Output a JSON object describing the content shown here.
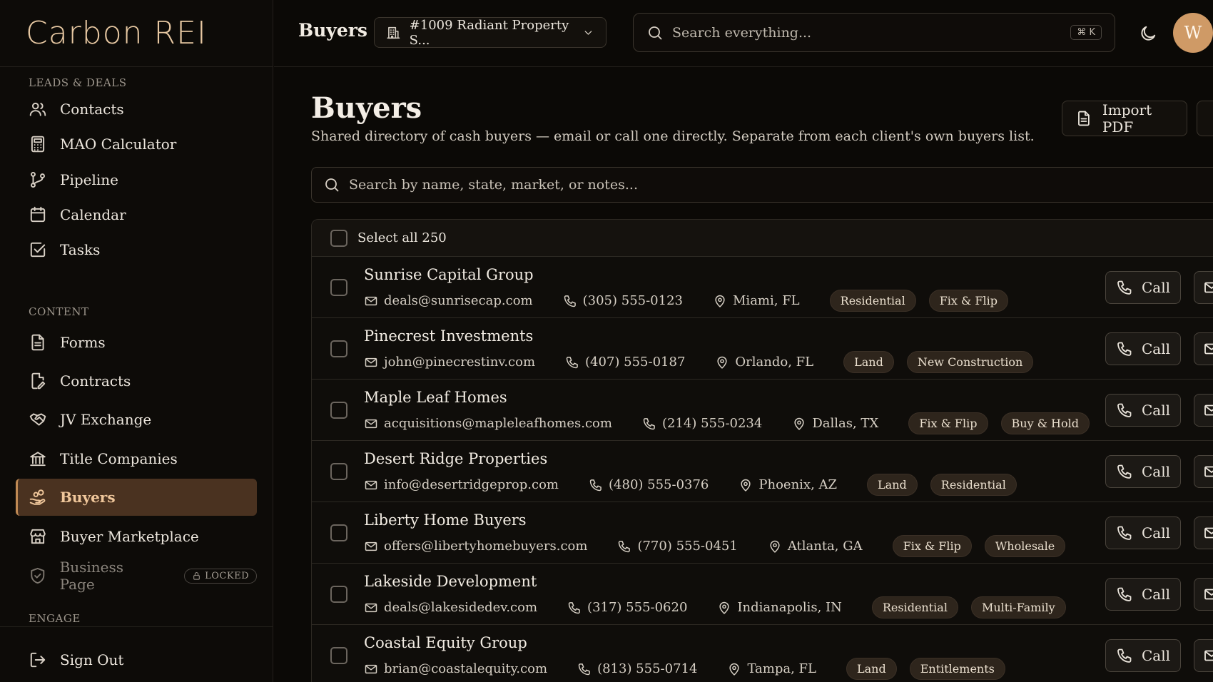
{
  "brand": {
    "logo_text": "Carbon REI"
  },
  "sidebar": {
    "sections": [
      {
        "label": "Leads & Deals"
      },
      {
        "label": "Content"
      },
      {
        "label": "Engage"
      }
    ],
    "items": [
      {
        "label": "Contacts",
        "icon": "users-icon"
      },
      {
        "label": "MAO Calculator",
        "icon": "calculator-icon"
      },
      {
        "label": "Pipeline",
        "icon": "git-branch-icon"
      },
      {
        "label": "Calendar",
        "icon": "calendar-icon"
      },
      {
        "label": "Tasks",
        "icon": "checkbox-icon"
      },
      {
        "label": "Forms",
        "icon": "file-text-icon"
      },
      {
        "label": "Contracts",
        "icon": "file-edit-icon"
      },
      {
        "label": "JV Exchange",
        "icon": "handshake-icon"
      },
      {
        "label": "Title Companies",
        "icon": "bank-icon"
      },
      {
        "label": "Buyers",
        "icon": "hand-coins-icon",
        "active": true
      },
      {
        "label": "Buyer Marketplace",
        "icon": "store-icon"
      },
      {
        "label": "Business Page",
        "icon": "shield-icon",
        "badge": "LOCKED"
      }
    ],
    "sign_out": {
      "label": "Sign Out",
      "icon": "log-out-icon"
    }
  },
  "topbar": {
    "title": "Buyers",
    "property_select": "#1009 Radiant Property S...",
    "search_placeholder": "Search everything...",
    "shortcut": "⌘ K",
    "avatar_initial": "W"
  },
  "main": {
    "title": "Buyers",
    "subtitle": "Shared directory of cash buyers — email or call one directly. Separate from each client's own buyers list.",
    "import_label": "Import PDF",
    "search_placeholder": "Search by name, state, market, or notes...",
    "select_all_label": "Select all 250",
    "call_label": "Call",
    "buyers": [
      {
        "name": "Sunrise Capital Group",
        "email": "deals@sunrisecap.com",
        "phone": "(305) 555-0123",
        "location": "Miami, FL",
        "tags": [
          "Residential",
          "Fix & Flip"
        ]
      },
      {
        "name": "Pinecrest Investments",
        "email": "john@pinecrestinv.com",
        "phone": "(407) 555-0187",
        "location": "Orlando, FL",
        "tags": [
          "Land",
          "New Construction"
        ]
      },
      {
        "name": "Maple Leaf Homes",
        "email": "acquisitions@mapleleafhomes.com",
        "phone": "(214) 555-0234",
        "location": "Dallas, TX",
        "tags": [
          "Fix & Flip",
          "Buy & Hold"
        ]
      },
      {
        "name": "Desert Ridge Properties",
        "email": "info@desertridgeprop.com",
        "phone": "(480) 555-0376",
        "location": "Phoenix, AZ",
        "tags": [
          "Land",
          "Residential"
        ]
      },
      {
        "name": "Liberty Home Buyers",
        "email": "offers@libertyhomebuyers.com",
        "phone": "(770) 555-0451",
        "location": "Atlanta, GA",
        "tags": [
          "Fix & Flip",
          "Wholesale"
        ]
      },
      {
        "name": "Lakeside Development",
        "email": "deals@lakesidedev.com",
        "phone": "(317) 555-0620",
        "location": "Indianapolis, IN",
        "tags": [
          "Residential",
          "Multi-Family"
        ]
      },
      {
        "name": "Coastal Equity Group",
        "email": "brian@coastalequity.com",
        "phone": "(813) 555-0714",
        "location": "Tampa, FL",
        "tags": [
          "Land",
          "Entitlements"
        ]
      }
    ]
  },
  "colors": {
    "accent": "#c08a54",
    "active_bg": "#4a3220",
    "background": "#0b0906",
    "avatar": "#cf9a66"
  }
}
